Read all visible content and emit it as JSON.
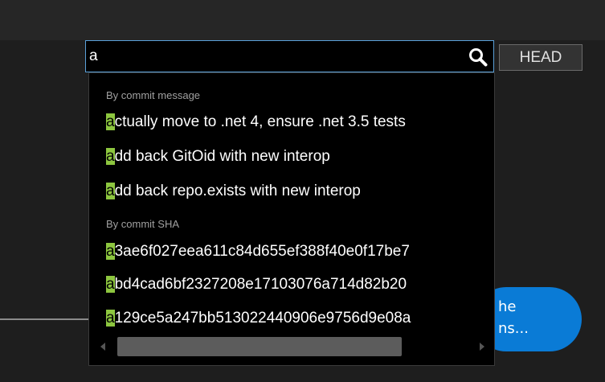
{
  "search": {
    "value": "a",
    "placeholder": ""
  },
  "head_button": {
    "label": "HEAD"
  },
  "dropdown": {
    "sections": [
      {
        "title": "By commit message",
        "items": [
          {
            "match": "a",
            "rest": "ctually move to .net 4, ensure .net 3.5 tests"
          },
          {
            "match": "a",
            "rest": "dd back GitOid with new interop"
          },
          {
            "match": "a",
            "rest": "dd back repo.exists with new interop"
          }
        ]
      },
      {
        "title": "By commit SHA",
        "items": [
          {
            "match": "a",
            "rest": "3ae6f027eea611c84d655ef388f40e0f17be7"
          },
          {
            "match": "a",
            "rest": "bd4cad6bf2327208e17103076a714d82b20"
          },
          {
            "match": "a",
            "rest": "129ce5a247bb513022440906e9756d9e08a"
          }
        ]
      }
    ]
  },
  "bubble": {
    "line1": "he",
    "line2": "ns..."
  },
  "colors": {
    "highlight": "#8dc63f",
    "bubble": "#0a7bd6",
    "search_border": "#5aa0d8"
  },
  "icons": {
    "search": "magnifier-icon",
    "scroll_left": "chevron-left-icon",
    "scroll_right": "chevron-right-icon"
  }
}
